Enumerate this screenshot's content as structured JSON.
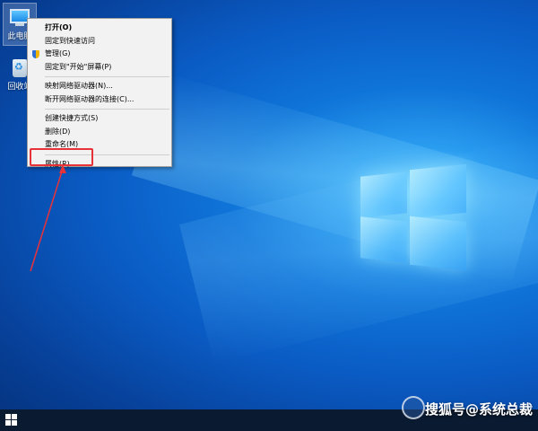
{
  "desktop": {
    "icons": [
      {
        "label": "此电脑",
        "icon": "computer-icon"
      },
      {
        "label": "回收站",
        "icon": "recycle-bin-icon"
      }
    ]
  },
  "context_menu": {
    "items": [
      {
        "label": "打开(O)",
        "bold": true
      },
      {
        "label": "固定到快速访问"
      },
      {
        "label": "管理(G)",
        "icon": "admin-shield-icon"
      },
      {
        "label": "固定到\"开始\"屏幕(P)"
      },
      {
        "separator": true
      },
      {
        "label": "映射网络驱动器(N)..."
      },
      {
        "label": "断开网络驱动器的连接(C)..."
      },
      {
        "separator": true
      },
      {
        "label": "创建快捷方式(S)"
      },
      {
        "label": "删除(D)"
      },
      {
        "label": "重命名(M)"
      },
      {
        "separator": true
      },
      {
        "label": "属性(R)"
      }
    ]
  },
  "annotation": {
    "highlight_color": "#e8323a"
  },
  "watermark": {
    "text": "搜狐号@系统总裁"
  },
  "taskbar": {
    "start_icon": "windows-start-icon"
  }
}
